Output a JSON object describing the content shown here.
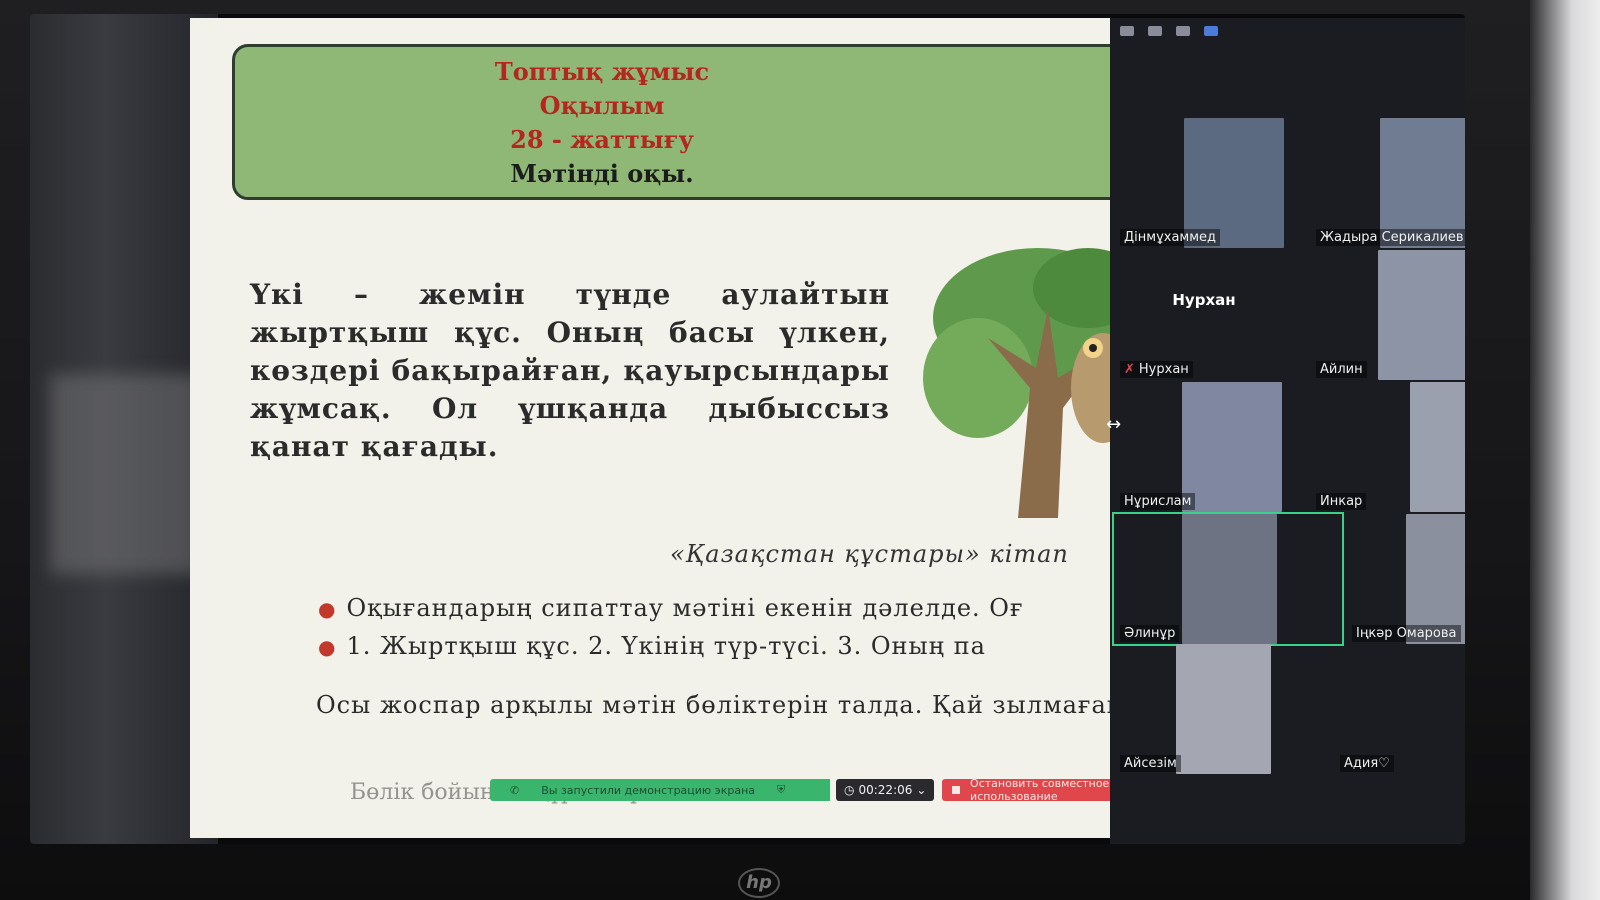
{
  "slide": {
    "header_lines": [
      "Топтық жұмыс",
      "Оқылым",
      "28 - жаттығу",
      "Мәтінді оқы."
    ],
    "body_text": "Үкі – жемін түнде аулайтын жыртқыш құс. Оның басы үлкен, көздері бақырайған, қауырсындары жұмсақ. Ол ұшқанда дыбыссыз қанат қағады.",
    "book_caption": "«Қазақстан құстары» кітап",
    "bullets": [
      "Оқығандарың сипаттау мәтіні екенін дәлелде. Оғ",
      "1. Жыртқыш құс. 2. Үкінің түр-түсі. 3. Оның па"
    ],
    "plan_question": "Осы жоспар арқылы мәтін бөліктерін талда. Қай зылмаған?",
    "cut_line": "Бөлік бойынша құрастырылған"
  },
  "share_bar": {
    "status": "Вы запустили демонстрацию экрана",
    "timer": "00:22:06",
    "stop_label": "Остановить совместное использование"
  },
  "participants": [
    {
      "name": "Дінмұхаммед",
      "color": "#5b6a80"
    },
    {
      "name": "Жадыра Серикалиев",
      "color": "#6f7c92"
    },
    {
      "name": "Нурхан",
      "color": "#1b1c22",
      "muted": true
    },
    {
      "name": "Айлин",
      "color": "#8d94a6"
    },
    {
      "name": "Нұрислам",
      "color": "#7f88a0"
    },
    {
      "name": "Инкар",
      "color": "#9aa0ae"
    },
    {
      "name": "Әлинұр",
      "color": "#6e7384"
    },
    {
      "name": "Іңкәр Омарова",
      "color": "#8b909e"
    },
    {
      "name": "Айсезім",
      "color": "#a4a7b2"
    },
    {
      "name": "Адия♡",
      "color": "#1b1c22"
    }
  ],
  "colors": {
    "header_bg": "#8fb877",
    "header_red": "#b5261e",
    "active_speaker": "#3ad18a",
    "stop_red": "#e0474c",
    "share_green": "#3ab56e"
  },
  "brand": "hp"
}
